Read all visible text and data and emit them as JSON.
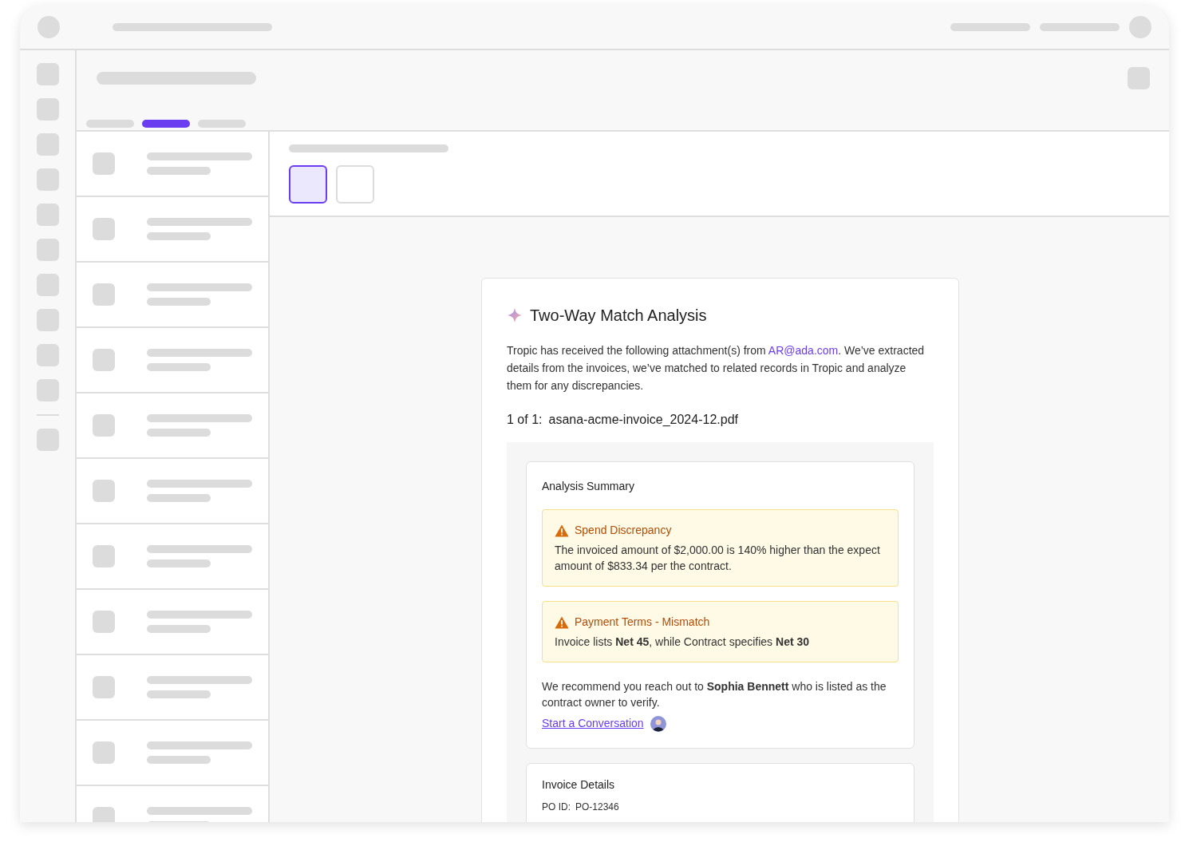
{
  "tabs": [
    {
      "selected": false
    },
    {
      "selected": true
    },
    {
      "selected": false
    }
  ],
  "view_toggles": [
    {
      "selected": true
    },
    {
      "selected": false
    }
  ],
  "card": {
    "title": "Two-Way Match Analysis",
    "intro_before": "Tropic has received the following attachment(s) from",
    "intro_link": "AR@ada.com",
    "intro_after": ". We’ve extracted details from the invoices, we’ve matched to related records in Tropic and analyze them for any discrepancies.",
    "file_index": "1 of 1:",
    "file_name": "asana-acme-invoice_2024-12.pdf",
    "summary": {
      "title": "Analysis Summary",
      "alerts": [
        {
          "title": "Spend Discrepancy",
          "body": "The invoiced amount of $2,000.00 is 140% higher than the expect amount of $833.34 per the contract."
        },
        {
          "title": "Payment Terms - Mismatch",
          "body": "Invoice lists **Net 45**, while Contract specifies **Net 30**"
        }
      ],
      "recommendation": "We recommend you reach out to **Sophia Bennett** who is listed as the contract owner to verify.",
      "link": "Start a Conversation"
    },
    "invoice_details": {
      "title": "Invoice Details",
      "fields": [
        {
          "label": "PO ID:",
          "value": "PO-12346"
        }
      ]
    }
  }
}
